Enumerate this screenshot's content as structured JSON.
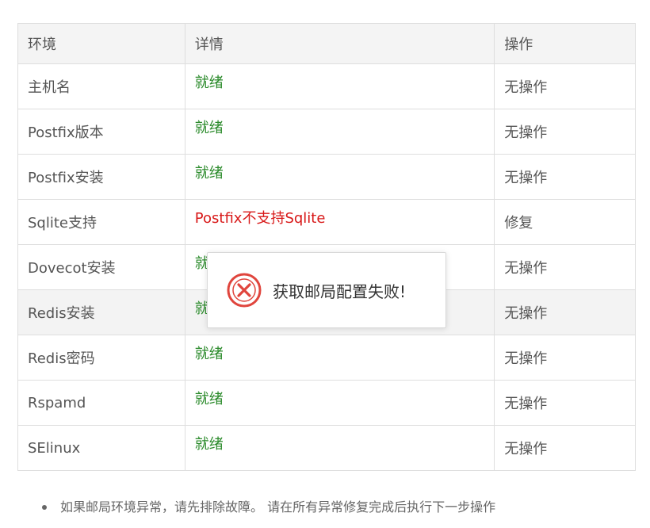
{
  "table": {
    "headers": {
      "environment": "环境",
      "details": "详情",
      "operation": "操作"
    },
    "rows": [
      {
        "environment": "主机名",
        "details": "就绪",
        "status": "ok",
        "operation": "无操作"
      },
      {
        "environment": "Postfix版本",
        "details": "就绪",
        "status": "ok",
        "operation": "无操作"
      },
      {
        "environment": "Postfix安装",
        "details": "就绪",
        "status": "ok",
        "operation": "无操作"
      },
      {
        "environment": "Sqlite支持",
        "details": "Postfix不支持Sqlite",
        "status": "error",
        "operation": "修复"
      },
      {
        "environment": "Dovecot安装",
        "details": "就绪",
        "status": "ok",
        "operation": "无操作"
      },
      {
        "environment": "Redis安装",
        "details": "就绪",
        "status": "ok",
        "operation": "无操作"
      },
      {
        "environment": "Redis密码",
        "details": "就绪",
        "status": "ok",
        "operation": "无操作"
      },
      {
        "environment": "Rspamd",
        "details": "就绪",
        "status": "ok",
        "operation": "无操作"
      },
      {
        "environment": "SElinux",
        "details": "就绪",
        "status": "ok",
        "operation": "无操作"
      }
    ]
  },
  "toast": {
    "icon": "error-circle-icon",
    "message": "获取邮局配置失败!"
  },
  "notes": [
    "如果邮局环境异常，请先排除故障。 请在所有异常修复完成后执行下一步操作"
  ],
  "colors": {
    "ok": "#2a8a2a",
    "error": "#d81818",
    "header_bg": "#f4f4f4",
    "border": "#dedede",
    "toast_icon": "#e0453d"
  }
}
